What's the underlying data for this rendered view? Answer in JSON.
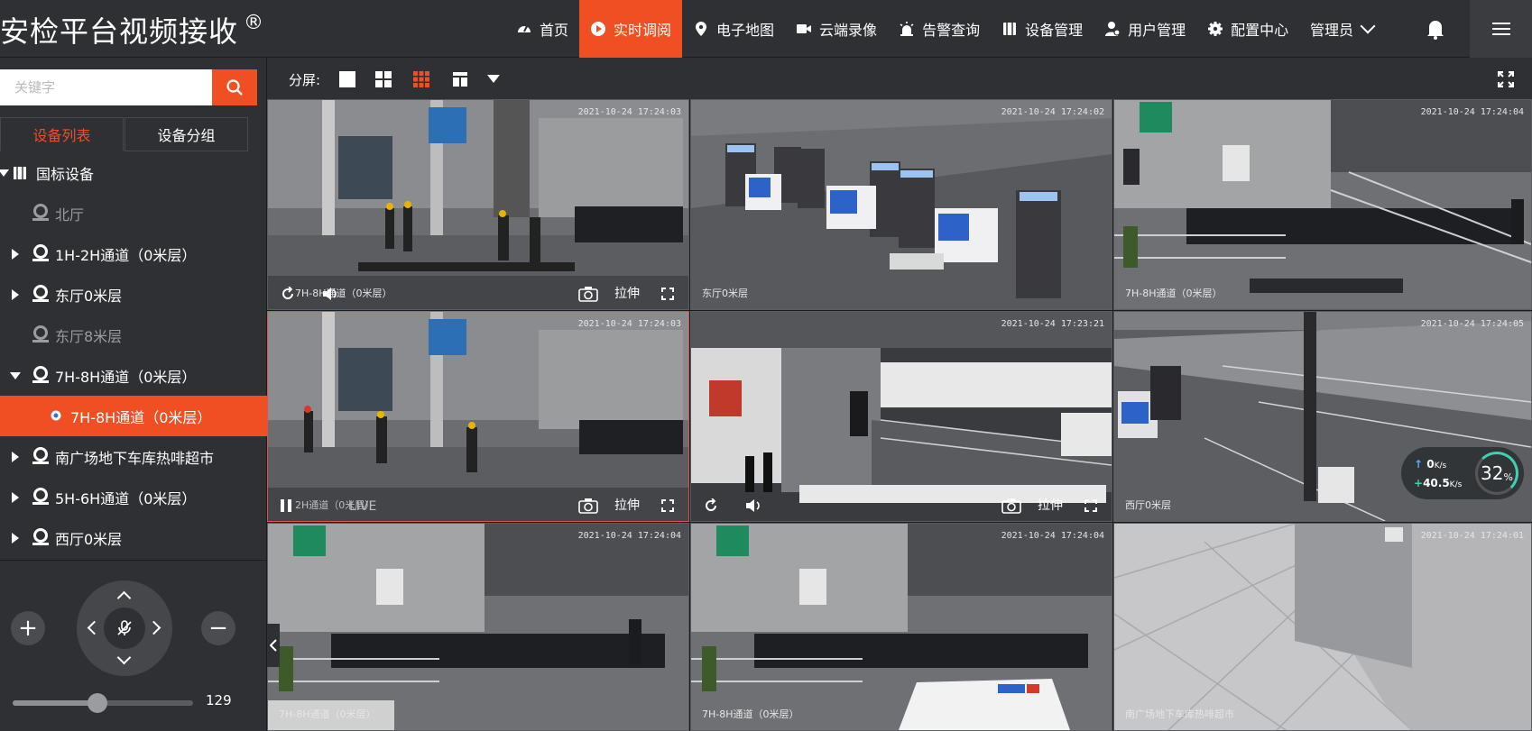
{
  "header": {
    "brand": "安检平台视频接收",
    "brand_mark": "®",
    "nav": [
      {
        "label": "首页",
        "icon": "dashboard-icon"
      },
      {
        "label": "实时调阅",
        "icon": "play-icon",
        "active": true
      },
      {
        "label": "电子地图",
        "icon": "map-pin-icon"
      },
      {
        "label": "云端录像",
        "icon": "video-camera-icon"
      },
      {
        "label": "告警查询",
        "icon": "alarm-icon"
      },
      {
        "label": "设备管理",
        "icon": "device-icon"
      },
      {
        "label": "用户管理",
        "icon": "user-icon"
      },
      {
        "label": "配置中心",
        "icon": "gear-icon"
      }
    ],
    "user": "管理员",
    "accent": "#f04e23"
  },
  "sidebar": {
    "search_placeholder": "关键字",
    "tabs": [
      "设备列表",
      "设备分组"
    ],
    "tree": [
      {
        "label": "国标设备",
        "icon": "book-icon",
        "arrow": "down",
        "level": 0
      },
      {
        "label": "北厅",
        "icon": "camera-icon",
        "level": 1,
        "dim": true
      },
      {
        "label": "1H-2H通道（0米层）",
        "icon": "camera-icon",
        "arrow": "right",
        "level": 1
      },
      {
        "label": "东厅0米层",
        "icon": "camera-icon",
        "arrow": "right",
        "level": 1
      },
      {
        "label": "东厅8米层",
        "icon": "camera-icon",
        "level": 1,
        "dim": true
      },
      {
        "label": "7H-8H通道（0米层）",
        "icon": "camera-icon",
        "arrow": "down",
        "level": 1
      },
      {
        "label": "7H-8H通道（0米层）",
        "icon": "camera-icon",
        "level": 2,
        "selected": true
      },
      {
        "label": "南广场地下车库热啡超市",
        "icon": "camera-icon",
        "arrow": "right",
        "level": 1
      },
      {
        "label": "5H-6H通道（0米层）",
        "icon": "camera-icon",
        "arrow": "right",
        "level": 1
      },
      {
        "label": "西厅0米层",
        "icon": "camera-icon",
        "arrow": "right",
        "level": 1
      }
    ],
    "ptz": {
      "zoom_in": "+",
      "zoom_out": "−",
      "slider_value": "129",
      "slider_fraction": 0.47
    }
  },
  "toolbar": {
    "split_label": "分屏:",
    "layouts": [
      "1x1",
      "2x2",
      "3x3",
      "custom"
    ]
  },
  "grid": {
    "tiles": [
      {
        "timestamp": "2021-10-24 17:24:03",
        "name": "7H-8H通道（0米层）",
        "controls": true,
        "stretch": "拉伸"
      },
      {
        "timestamp": "2021-10-24 17:24:02",
        "name": "东厅0米层",
        "controls": false
      },
      {
        "timestamp": "2021-10-24 17:24:04",
        "name": "7H-8H通道（0米层）",
        "controls": false
      },
      {
        "timestamp": "2021-10-24 17:24:03",
        "name": "2H通道（0米层）",
        "live": "LIVE",
        "controls": true,
        "selected": true,
        "stretch": "拉伸"
      },
      {
        "timestamp": "2021-10-24 17:23:21",
        "name": "",
        "controls": true,
        "stretch": "拉伸"
      },
      {
        "timestamp": "2021-10-24 17:24:05",
        "name": "西厅0米层",
        "controls": false,
        "net": {
          "up": "0",
          "up_unit": "K/s",
          "down": "40.5",
          "down_unit": "K/s",
          "percent": "32",
          "percent_unit": "%"
        }
      },
      {
        "timestamp": "2021-10-24 17:24:04",
        "name": "7H-8H通道（0米层）",
        "controls": false
      },
      {
        "timestamp": "2021-10-24 17:24:04",
        "name": "7H-8H通道（0米层）",
        "controls": false
      },
      {
        "timestamp": "2021-10-24 17:24:01",
        "name": "南广场地下车库热啡超市",
        "controls": false
      }
    ]
  }
}
